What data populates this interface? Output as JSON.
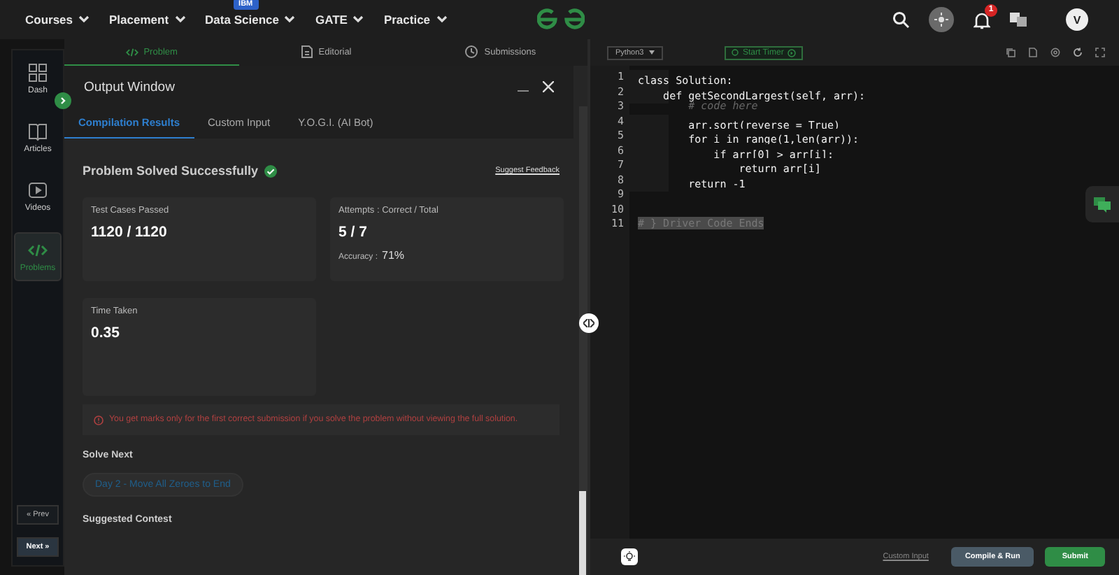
{
  "nav": {
    "items": [
      {
        "label": "Courses"
      },
      {
        "label": "Placement"
      },
      {
        "label": "Data Science",
        "badge": "IBM"
      },
      {
        "label": "GATE"
      },
      {
        "label": "Practice"
      }
    ],
    "notifications": "1",
    "avatar": "V"
  },
  "sidebar": {
    "items": [
      {
        "label": "Dash",
        "kind": "dash",
        "selected": false
      },
      {
        "label": "Articles",
        "kind": "book",
        "selected": false
      },
      {
        "label": "Videos",
        "kind": "video",
        "selected": false
      },
      {
        "label": "Problems",
        "kind": "code",
        "selected": true
      }
    ],
    "prev": "« Prev",
    "next": "Next »"
  },
  "problem_tabs": [
    {
      "label": "Problem",
      "kind": "code",
      "selected": true
    },
    {
      "label": "Editorial",
      "kind": "doc",
      "selected": false
    },
    {
      "label": "Submissions",
      "kind": "clock",
      "selected": false
    }
  ],
  "output_window": {
    "title": "Output Window",
    "tabs": [
      {
        "label": "Compilation Results",
        "selected": true
      },
      {
        "label": "Custom Input",
        "selected": false
      },
      {
        "label": "Y.O.G.I. (AI Bot)",
        "selected": false
      }
    ],
    "status": "Problem Solved Successfully",
    "feedback_link": "Suggest Feedback",
    "stats": [
      {
        "label": "Test Cases Passed",
        "value": "1120 / 1120"
      },
      {
        "label": "Attempts : Correct / Total",
        "value": "5 / 7",
        "note_label": "Accuracy :",
        "note_value": "71%"
      },
      {
        "label": "Time Taken",
        "value": "0.35"
      }
    ],
    "notice": "You get marks only for the first correct submission if you solve the problem without viewing the full solution.",
    "solve_next_heading": "Solve Next",
    "solve_next": "Day 2 - Move All Zeroes to End",
    "suggested_heading": "Suggested Contest"
  },
  "editor": {
    "language": "Python3",
    "timer": "Start Timer",
    "lines": [
      {
        "number": "1",
        "code": "class Solution:",
        "kind": "code"
      },
      {
        "number": "2",
        "code": "    def getSecondLargest(self, arr):",
        "kind": "code"
      },
      {
        "number": "3",
        "code": "        # code here",
        "kind": "comment"
      },
      {
        "number": "4",
        "code": "        arr.sort(reverse = True)",
        "kind": "code"
      },
      {
        "number": "5",
        "code": "        for i in range(1,len(arr)):",
        "kind": "code"
      },
      {
        "number": "6",
        "code": "            if arr[0] > arr[i]:",
        "kind": "code"
      },
      {
        "number": "7",
        "code": "                return arr[i]",
        "kind": "code"
      },
      {
        "number": "8",
        "code": "        return -1",
        "kind": "code"
      },
      {
        "number": "9",
        "kind": "code"
      },
      {
        "number": "10",
        "kind": "code"
      },
      {
        "number": "11",
        "code": "# } Driver Code Ends",
        "kind": "folded"
      }
    ],
    "custom_input": "Custom Input",
    "buttons": [
      {
        "label": "Compile & Run",
        "kind": "secondary"
      },
      {
        "label": "Submit",
        "kind": "primary"
      }
    ]
  }
}
